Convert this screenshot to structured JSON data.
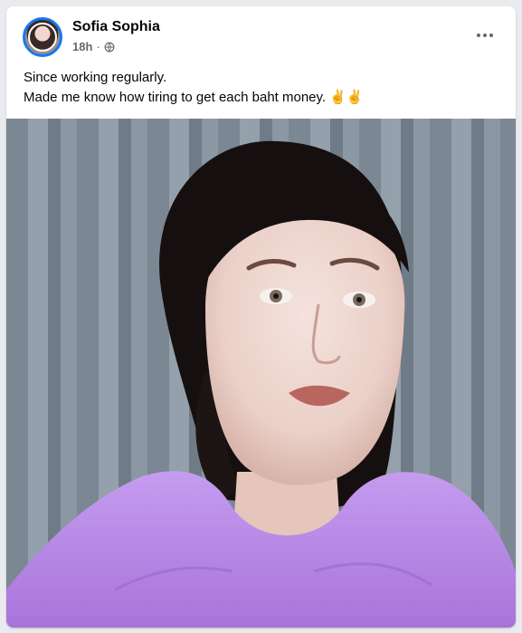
{
  "post": {
    "author": "Sofia Sophia",
    "time": "18h",
    "separator": "·",
    "audience_icon": "globe-icon",
    "text_lines": [
      "Since working regularly.",
      "Made me know how tiring to get each baht money. ✌️✌️"
    ],
    "photo_alt": "Selfie of a woman in a purple top"
  },
  "colors": {
    "accent": "#1877f2",
    "meta_gray": "#65676b",
    "text": "#050505",
    "top_purple": "#b88be0",
    "curtain_gray": "#7e8a95"
  }
}
